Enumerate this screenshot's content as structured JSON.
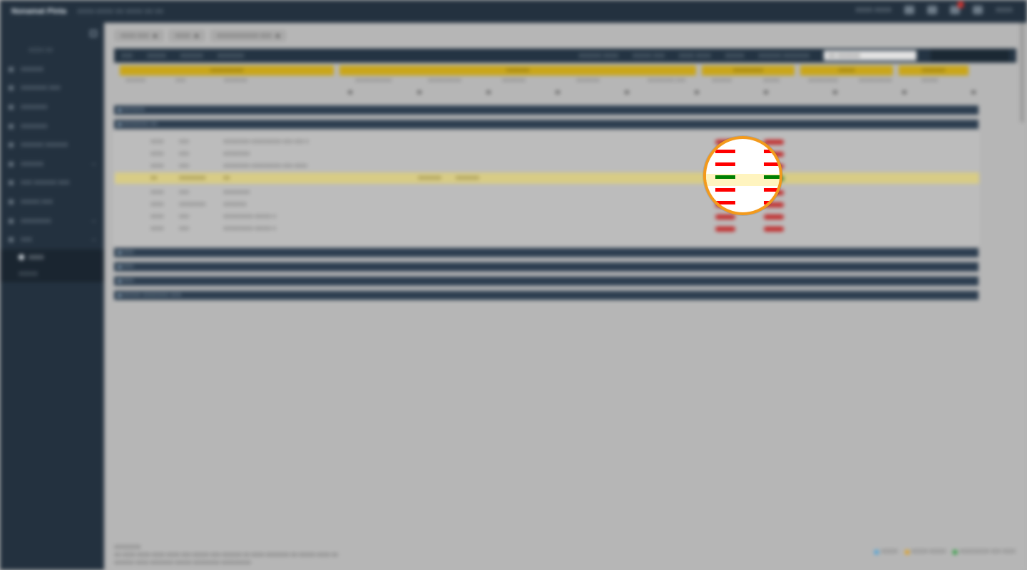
{
  "app": {
    "brand": "Nonamat Pinta",
    "breadcrumb": "XXXX-XXXX XX   XXXX XX XX",
    "user": "XXXX"
  },
  "topbar": {
    "status_text": "XXXX XXXX",
    "notification_count": "1"
  },
  "sidebar": {
    "search_placeholder": "XXXX XX",
    "items": [
      {
        "label": "XXXXXX"
      },
      {
        "label": "XXXXXXX XXX"
      },
      {
        "label": "XXXXXXX"
      },
      {
        "label": "XXXXXXX"
      },
      {
        "label": "XXXXXX XXXXXX"
      },
      {
        "label": "XXXXXX"
      },
      {
        "label": "XXX XXXXXX XXX"
      },
      {
        "label": "XXXXX XXX"
      },
      {
        "label": "XXXXXXXX"
      },
      {
        "label": "XXX"
      }
    ],
    "sub_items": [
      {
        "label": "XXXX"
      },
      {
        "label": "XXXXX"
      }
    ]
  },
  "main": {
    "tabs": [
      {
        "label": "XXXX XXX"
      },
      {
        "label": "XXXX"
      },
      {
        "label": "XXXXXXXXXXX XXX"
      }
    ],
    "toolbar": {
      "items": [
        "XXX",
        "XXXXX",
        "XXXXXX",
        "XXXXXXX"
      ],
      "right_items": [
        "XXXXXX XXXX",
        "XXXXX XXX",
        "XXXX XXXX",
        "XXXXX",
        "XXXXXX XXXXXXX"
      ],
      "search_value": "XX   XXXXXX"
    },
    "group_headers": [
      "XXXXXXXXXX",
      "XXXXXXX",
      "XXXXXXXXX",
      "XXXXX",
      "XXXXXXX"
    ],
    "sub_headers": [
      "XXXXXX",
      "XXX",
      "XXXXXXX",
      "XXXXXXXXXXX",
      "XXXXXXXXXX",
      "XXXXXXX",
      "XXXXXXX",
      "XXXXXXXX XXX",
      "XXXXXX",
      "XXXXX",
      "XXXXXXXXX",
      "XXXXXXXXXX",
      "XXXXX"
    ],
    "section_bars": [
      "XXXXXX",
      "XXXXXXX XX",
      "XXX",
      "XXX",
      "XXX",
      "XXXXX XXXXXXX XXX"
    ],
    "rows": [
      {
        "c1": "XXXX",
        "c2": "XXX",
        "c3": "XXXXXXXX XXXXXXXXX XXX XXX X"
      },
      {
        "c1": "XXXX",
        "c2": "XXX",
        "c3": "XXXXXXXX"
      },
      {
        "c1": "XXXX",
        "c2": "XXX",
        "c3": "XXXXXXXX XXXXXXXXX XXX XXXX"
      },
      {
        "c1": "XX",
        "c2": "XXXXXXXX",
        "c3": "XX",
        "c4": "XXXXXXX",
        "c5": "XXXXXXX"
      },
      {
        "c1": "XXXX",
        "c2": "XXX",
        "c3": "XXXXXXXX"
      },
      {
        "c1": "XXXX",
        "c2": "XXXXXXXX",
        "c3": "XXXXXXX"
      },
      {
        "c1": "XXXX",
        "c2": "XXX",
        "c3": "XXXXXXXXX XXXXX X"
      },
      {
        "c1": "XXXX",
        "c2": "XXX",
        "c3": "XXXXXXXXX XXXXX X"
      }
    ],
    "legend": [
      {
        "label": "XXXXX",
        "color": "#4aa3d8"
      },
      {
        "label": "XXXXX XXXXX",
        "color": "#e0a020"
      },
      {
        "label": "XXXXXXXXX XXX XXXX",
        "color": "#2e9e3e"
      }
    ],
    "footer": {
      "title": "XXXXXXXX",
      "line1": "XX XXXX XXXX XXXX XXXX XXX XXXXX XXX XXXXXX XX XXXX XXXXXXX XX XXXXX XXXX XX",
      "line2": "XXXXXX XXXX XXXXXXX XXXXX XXXXXXXX XXXXXXXXX"
    }
  },
  "magnifier": {
    "rows": [
      {
        "status": "red"
      },
      {
        "status": "red"
      },
      {
        "status": "green",
        "highlighted": true
      },
      {
        "status": "red"
      },
      {
        "status": "red"
      }
    ],
    "colors": {
      "ring": "#f39a1c",
      "red": "#ff0000",
      "green": "#008000",
      "highlight": "#fff4bf"
    }
  }
}
